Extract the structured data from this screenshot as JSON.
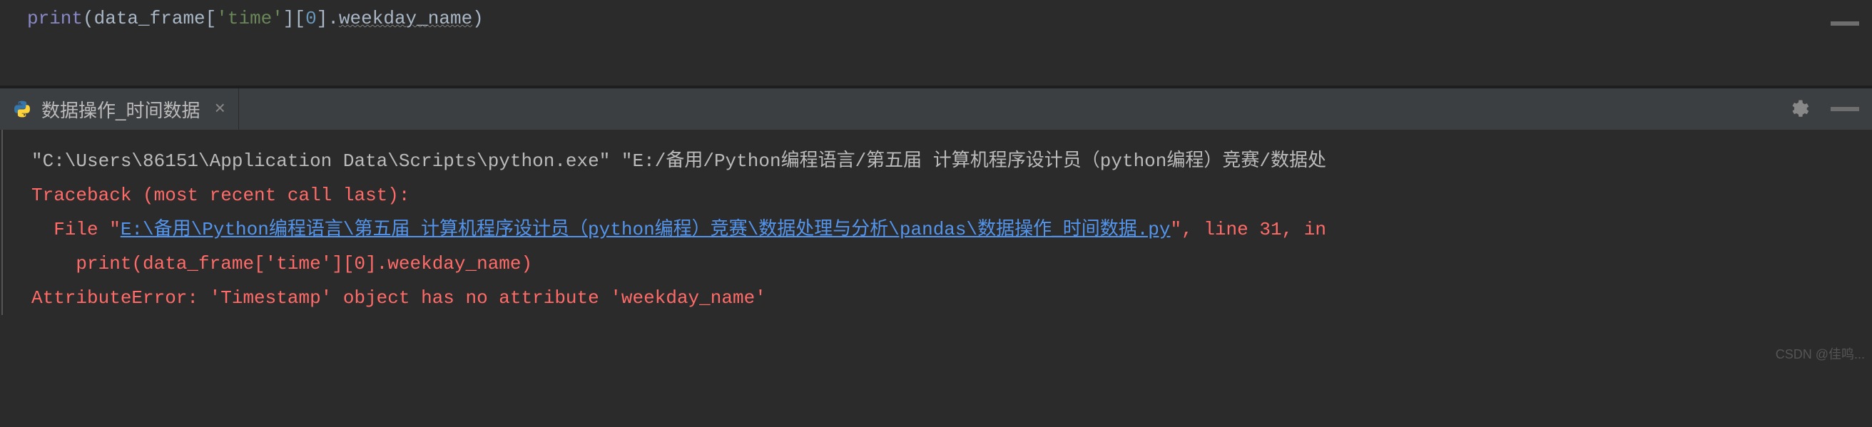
{
  "editor": {
    "code": {
      "func": "print",
      "open_paren": "(",
      "ident": "data_frame",
      "bracket_open": "[",
      "string": "'time'",
      "bracket_close": "]",
      "index_open": "[",
      "index_num": "0",
      "index_close": "]",
      "dot": ".",
      "attr": "weekday_name",
      "close_paren": ")"
    }
  },
  "tab": {
    "label": "数据操作_时间数据",
    "close_symbol": "×"
  },
  "console": {
    "line1_prefix": "\"C:\\Users\\86151\\Application Data\\Scripts\\python.exe\" \"E:/备用/Python编程语言/第五届 计算机程序设计员（python编程）竞赛/数据处",
    "line2": "Traceback (most recent call last):",
    "line3_file": "  File \"",
    "line3_path": "E:\\备用\\Python编程语言\\第五届 计算机程序设计员（python编程）竞赛\\数据处理与分析\\pandas\\数据操作_时间数据.py",
    "line3_suffix": "\", line 31, in",
    "line4": "    print(data_frame['time'][0].weekday_name)",
    "line5": "AttributeError: 'Timestamp' object has no attribute 'weekday_name'"
  },
  "watermark": "CSDN @佳鸣..."
}
